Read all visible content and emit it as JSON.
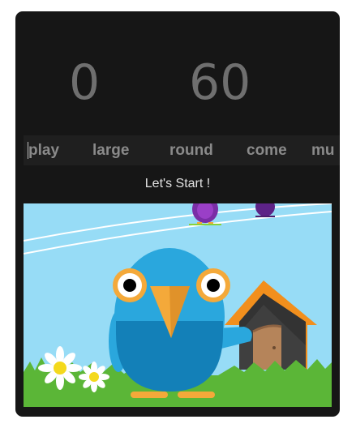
{
  "scoreboard": {
    "score": "0",
    "timer": "60"
  },
  "word_strip": {
    "words": [
      "play",
      "large",
      "round",
      "come",
      "mu"
    ]
  },
  "status": {
    "message": "Let's Start !"
  },
  "scene": {
    "icons": [
      "purple-bird-icon",
      "small-purple-bird-icon",
      "blue-bird-icon",
      "birdhouse-icon",
      "daisy-flower-icon"
    ],
    "colors": {
      "sky": "#97dcf6",
      "grass": "#5bb637",
      "bird_body": "#2aa7dd",
      "bird_belly": "#1380b8",
      "beak": "#f4a93a",
      "roof": "#f28f1d"
    }
  }
}
